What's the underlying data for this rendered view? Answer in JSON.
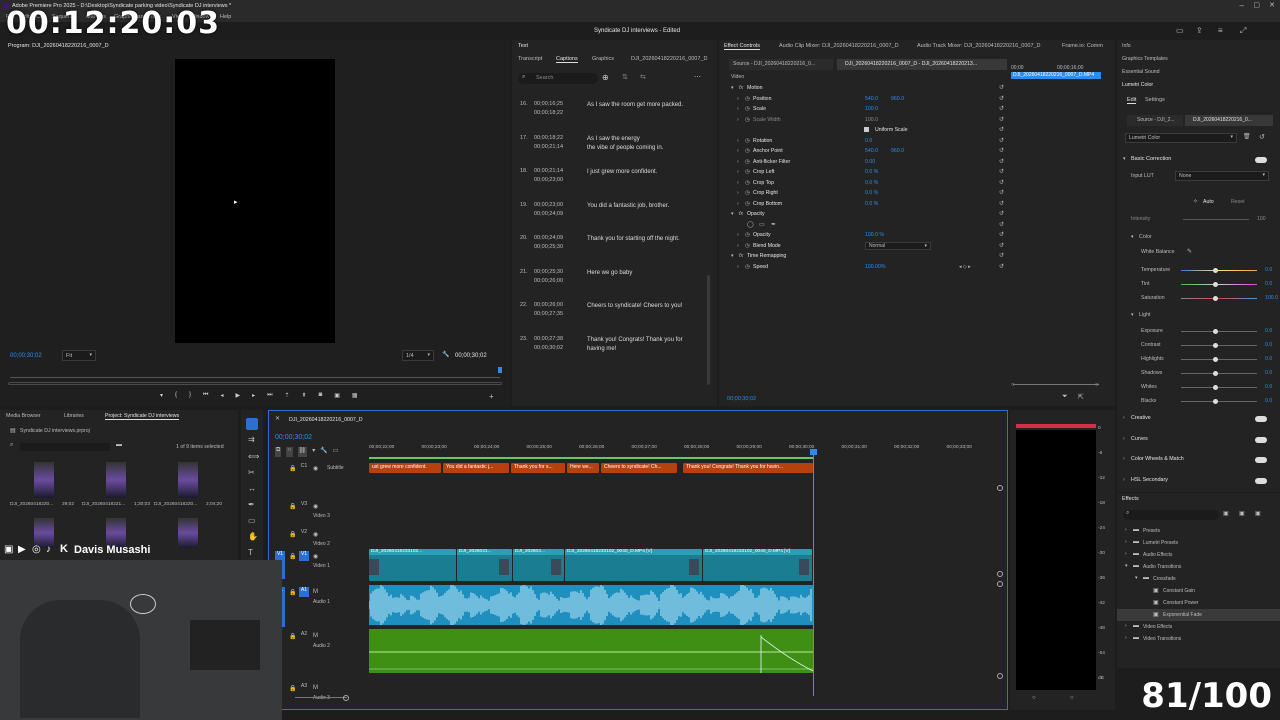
{
  "window": {
    "title": "Adobe Premiere Pro 2025 - D:\\Desktop\\Syndicate parking video\\Syndicate DJ interviews *",
    "center_title": "Syndicate DJ interviews - Edited"
  },
  "menu": [
    "File",
    "Edit",
    "Clip",
    "Sequence",
    "Markers",
    "Graphics and Titles",
    "View",
    "Window",
    "Help"
  ],
  "overlay": {
    "timecode": "00:12:20:03",
    "counter": "81/100",
    "streamer_name": "Davis Musashi"
  },
  "program": {
    "title": "Program: DJI_20260418220216_0007_D",
    "timecode": "00;00;30;02",
    "fit": "Fit",
    "quality": "1/4",
    "duration": "00;00;30;02"
  },
  "captions_panel": {
    "tabs": [
      "Text",
      "Transcript",
      "Captions",
      "Graphics",
      "DJI_20260418220216_0007_D"
    ],
    "search_placeholder": "Search",
    "rows": [
      {
        "num": "16.",
        "in": "00;00;16;25",
        "out": "00;00;18;22",
        "text": "As I saw the room get more packed."
      },
      {
        "num": "17.",
        "in": "00;00;18;22",
        "out": "00;00;21;14",
        "text": "As I saw the energy\nthe vibe of people coming in."
      },
      {
        "num": "18.",
        "in": "00;00;21;14",
        "out": "00;00;23;00",
        "text": "I just grew more confident."
      },
      {
        "num": "19.",
        "in": "00;00;23;00",
        "out": "00;00;24;09",
        "text": "You did a fantastic job, brother."
      },
      {
        "num": "20.",
        "in": "00;00;24;09",
        "out": "00;00;25;30",
        "text": "Thank you for starting off the night."
      },
      {
        "num": "21.",
        "in": "00;00;25;30",
        "out": "00;00;26;00",
        "text": "Here we go baby"
      },
      {
        "num": "22.",
        "in": "00;00;26;00",
        "out": "00;00;27;35",
        "text": "Cheers to syndicate! Cheers to you!"
      },
      {
        "num": "23.",
        "in": "00;00;27;38",
        "out": "00;00;30;02",
        "text": "Thank you! Congrats! Thank you for\nhaving me!"
      }
    ]
  },
  "effect_controls": {
    "tabs": [
      "Effect Controls",
      "Audio Clip Mixer: DJI_20260418220216_0007_D",
      "Audio Track Mixer: DJI_20260418220216_0007_D",
      "Frame.io: Comm"
    ],
    "source": "Source - DJI_20260418220216_0...",
    "clip": "DJI_20260418220216_0007_D - DJI_20260418220213...",
    "mini_clip": "DJI_20260418220216_0007_D.MP4",
    "mini_tc": [
      "00;00",
      "00;00;16;00"
    ],
    "video_label": "Video",
    "rows": [
      {
        "label": "Motion",
        "v1": "",
        "v2": "",
        "group": true
      },
      {
        "label": "Position",
        "v1": "540.0",
        "v2": "960.0"
      },
      {
        "label": "Scale",
        "v1": "100.0",
        "v2": ""
      },
      {
        "label": "Scale Width",
        "v1": "100.0",
        "v2": "",
        "disabled": true
      },
      {
        "label": "Uniform Scale",
        "v1": "",
        "v2": "",
        "check": true
      },
      {
        "label": "Rotation",
        "v1": "0.0",
        "v2": ""
      },
      {
        "label": "Anchor Point",
        "v1": "540.0",
        "v2": "960.0"
      },
      {
        "label": "Anti-flicker Filter",
        "v1": "0.00",
        "v2": ""
      },
      {
        "label": "Crop Left",
        "v1": "0.0 %",
        "v2": ""
      },
      {
        "label": "Crop Top",
        "v1": "0.0 %",
        "v2": ""
      },
      {
        "label": "Crop Right",
        "v1": "0.0 %",
        "v2": ""
      },
      {
        "label": "Crop Bottom",
        "v1": "0.0 %",
        "v2": ""
      },
      {
        "label": "Opacity",
        "v1": "",
        "v2": "",
        "group": true
      },
      {
        "label": "",
        "v1": "",
        "v2": "",
        "masks": true
      },
      {
        "label": "Opacity",
        "v1": "100.0 %",
        "v2": ""
      },
      {
        "label": "Blend Mode",
        "v1": "Normal",
        "v2": "",
        "select": true
      },
      {
        "label": "Time Remapping",
        "v1": "",
        "v2": "",
        "group": true
      },
      {
        "label": "Speed",
        "v1": "100.00%",
        "v2": ""
      }
    ],
    "bottom_tc": "00;00;30;02"
  },
  "right_tabs": [
    "Info",
    "Graphics Templates",
    "Essential Sound",
    "Lumetri Color"
  ],
  "lumetri": {
    "tabs": [
      "Edit",
      "Settings"
    ],
    "source": "Source - DJI_2...",
    "clip": "DJI_20260418220216_0...",
    "effect": "Lumetri Color",
    "basic_correction": "Basic Correction",
    "input_lut_label": "Input LUT",
    "input_lut": "None",
    "auto": "Auto",
    "reset": "Reset",
    "intensity_label": "Intensity",
    "intensity_value": "100",
    "color_label": "Color",
    "white_balance": "White Balance",
    "color_rows": [
      {
        "label": "Temperature",
        "value": "0.0"
      },
      {
        "label": "Tint",
        "value": "0.0"
      },
      {
        "label": "Saturation",
        "value": "100.0"
      }
    ],
    "light_label": "Light",
    "light_rows": [
      {
        "label": "Exposure",
        "value": "0.0"
      },
      {
        "label": "Contrast",
        "value": "0.0"
      },
      {
        "label": "Highlights",
        "value": "0.0"
      },
      {
        "label": "Shadows",
        "value": "0.0"
      },
      {
        "label": "Whites",
        "value": "0.0"
      },
      {
        "label": "Blacks",
        "value": "0.0"
      }
    ],
    "sections": [
      "Creative",
      "Curves",
      "Color Wheels & Match",
      "HSL Secondary"
    ]
  },
  "effects": {
    "title": "Effects",
    "tree": [
      {
        "label": "Presets",
        "indent": 0
      },
      {
        "label": "Lumetri Presets",
        "indent": 0
      },
      {
        "label": "Audio Effects",
        "indent": 0
      },
      {
        "label": "Audio Transitions",
        "indent": 0
      },
      {
        "label": "Crossfade",
        "indent": 1
      },
      {
        "label": "Constant Gain",
        "indent": 2
      },
      {
        "label": "Constant Power",
        "indent": 2
      },
      {
        "label": "Exponential Fade",
        "indent": 2,
        "selected": true
      },
      {
        "label": "Video Effects",
        "indent": 0
      },
      {
        "label": "Video Transitions",
        "indent": 0
      }
    ]
  },
  "project": {
    "tabs": [
      "Media Browser",
      "Libraries",
      "Project: Syndicate DJ interviews"
    ],
    "file": "Syndicate DJ interviews.prproj",
    "count": "1 of 9 items selected",
    "items": [
      {
        "name": "DJI_20260418220...",
        "dur": "29;02"
      },
      {
        "name": "DJI_20260418221...",
        "dur": "1;30;03"
      },
      {
        "name": "DJI_20260418220...",
        "dur": "2;04;20"
      }
    ]
  },
  "timeline": {
    "sequence": "DJI_20260418220216_0007_D",
    "timecode": "00;00;30;02",
    "ruler": [
      "00;00;22;00",
      "00;00;23;00",
      "00;00;24;00",
      "00;00;25;00",
      "00;00;26;00",
      "00;00;27;00",
      "00;00;28;00",
      "00;00;29;00",
      "00;00;30;00",
      "00;00;31;00",
      "00;00;32;00",
      "00;00;33;00"
    ],
    "tracks": {
      "subtitle": "Subtitle",
      "v3": "Video 3",
      "v2": "Video 2",
      "v1": "Video 1",
      "a1": "Audio 1",
      "a2": "Audio 2",
      "a3": "Audio 3"
    },
    "track_ids": {
      "c1": "C1",
      "v3": "V3",
      "v2": "V2",
      "v1": "V1",
      "a1": "A1",
      "a2": "A2",
      "a3": "A3",
      "src_v": "V1",
      "src_a": "A1"
    },
    "subtitle_clips": [
      "ust grew more confident.",
      "You did a fantastic j...",
      "Thank you for s...",
      "Here we...",
      "Cheers to syndicate! Ch...",
      "Thank you! Congrats! Thank you for havin..."
    ],
    "video_clips": [
      "DJI_20260418233102...",
      "DJI_2026041...",
      "DJI_202604...",
      "DJI_20260418233102_0040_D.MP4 [V]",
      "DJI_20260418233102_0040_D.MP4 [V]"
    ]
  },
  "meter": {
    "labels": [
      "0",
      "-6",
      "-12",
      "-18",
      "-24",
      "-30",
      "-36",
      "-42",
      "-48",
      "-54",
      "dB"
    ]
  },
  "colors": {
    "accent": "#2d8ceb",
    "subtitle_clip": "#b5410f",
    "video_clip": "#1a7d91",
    "audio_clip": "#1f8fbf",
    "audio2_clip": "#3f8f14"
  }
}
